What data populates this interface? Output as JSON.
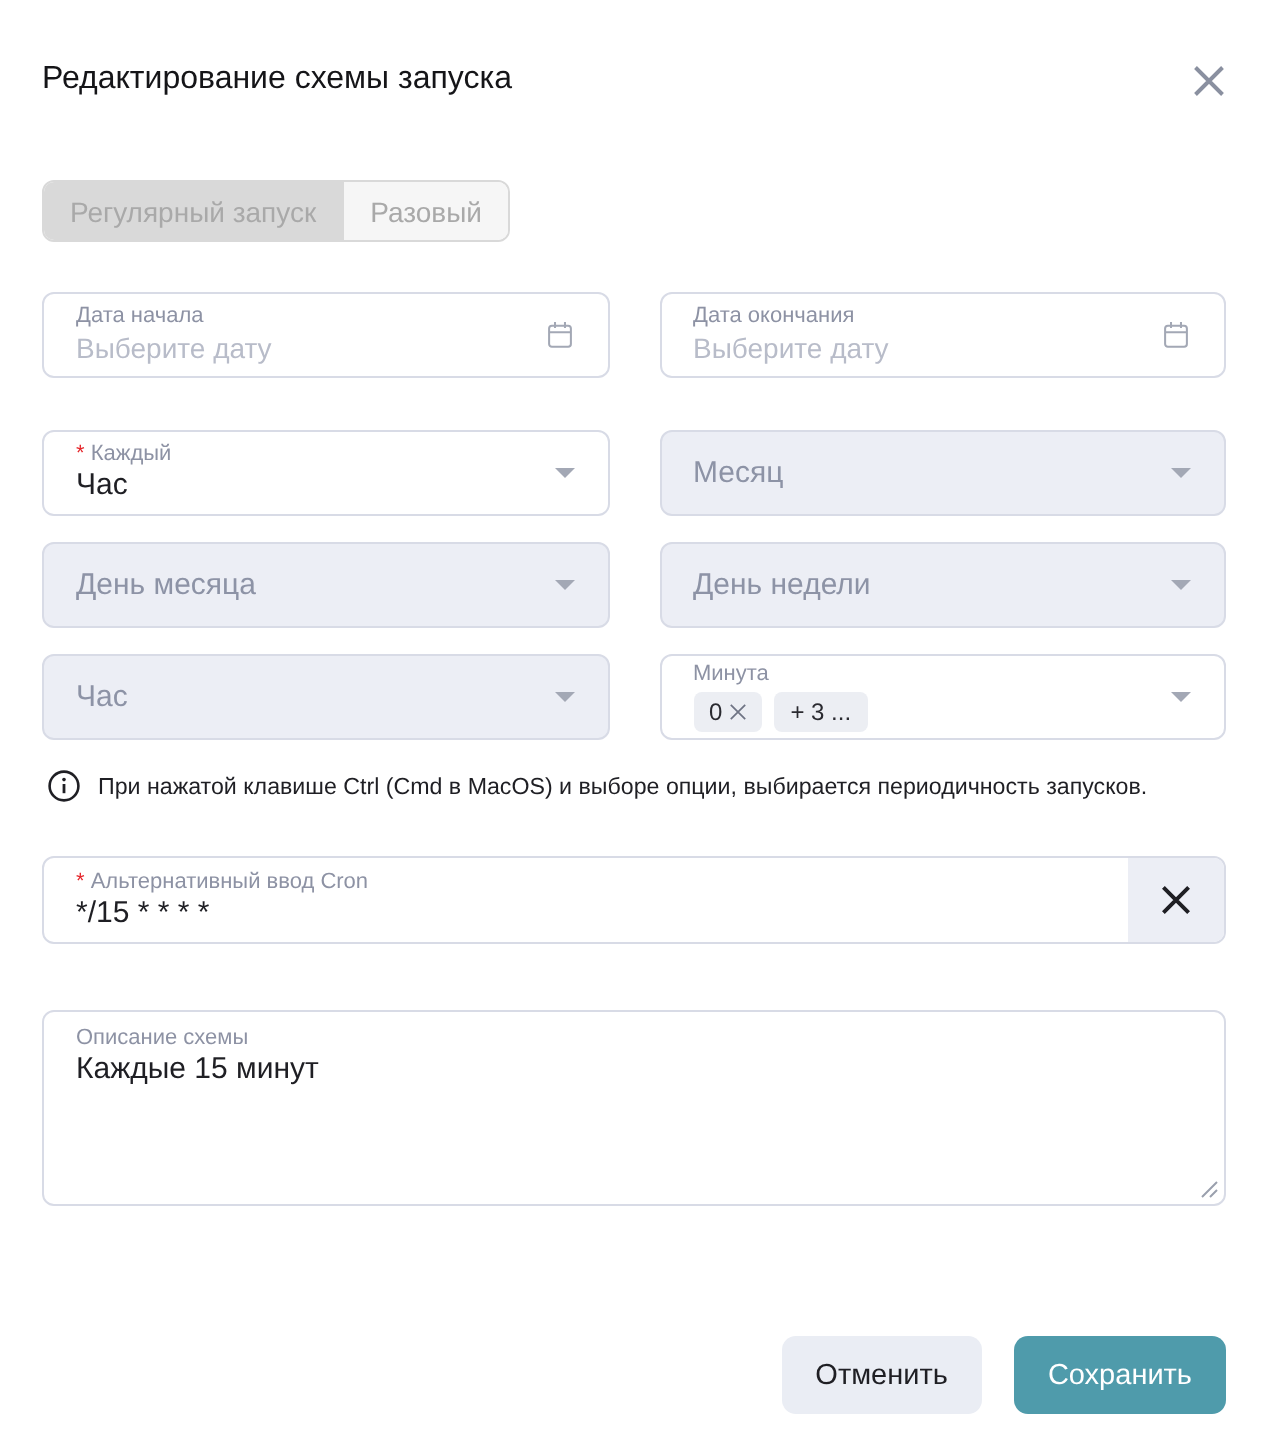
{
  "dialog": {
    "title": "Редактирование схемы запуска"
  },
  "mode_switch": {
    "disabled": true,
    "options": [
      {
        "label": "Регулярный запуск",
        "selected": true
      },
      {
        "label": "Разовый",
        "selected": false
      }
    ]
  },
  "date_fields": [
    {
      "label": "Дата начала",
      "placeholder": "Выберите дату"
    },
    {
      "label": "Дата окончания",
      "placeholder": "Выберите дату"
    }
  ],
  "select_rows": [
    {
      "fields": [
        {
          "label": "Каждый",
          "required_mark": "*",
          "disabled": false,
          "value": "Час"
        },
        {
          "placeholder": "Месяц",
          "disabled": true
        }
      ]
    },
    {
      "fields": [
        {
          "placeholder": "День месяца",
          "disabled": true
        },
        {
          "placeholder": "День недели",
          "disabled": true
        }
      ]
    },
    {
      "fields": [
        {
          "placeholder": "Час",
          "disabled": true
        },
        {
          "label": "Минута",
          "disabled": false,
          "tags": [
            {
              "text": "0",
              "removable": true
            },
            {
              "text": "+ 3 ...",
              "removable": false
            }
          ]
        }
      ]
    }
  ],
  "hint": "При нажатой клавише Ctrl (Cmd в MacOS) и выборе опции, выбирается периодичность запусков.",
  "cron_field": {
    "label": "Альтернативный ввод Cron",
    "required_mark": "*",
    "value": "*/15 * * * *"
  },
  "description_field": {
    "label": "Описание схемы",
    "value": "Каждые 15 минут"
  },
  "buttons": [
    {
      "label": "Отменить",
      "kind": "secondary"
    },
    {
      "label": "Сохранить",
      "kind": "primary"
    }
  ]
}
